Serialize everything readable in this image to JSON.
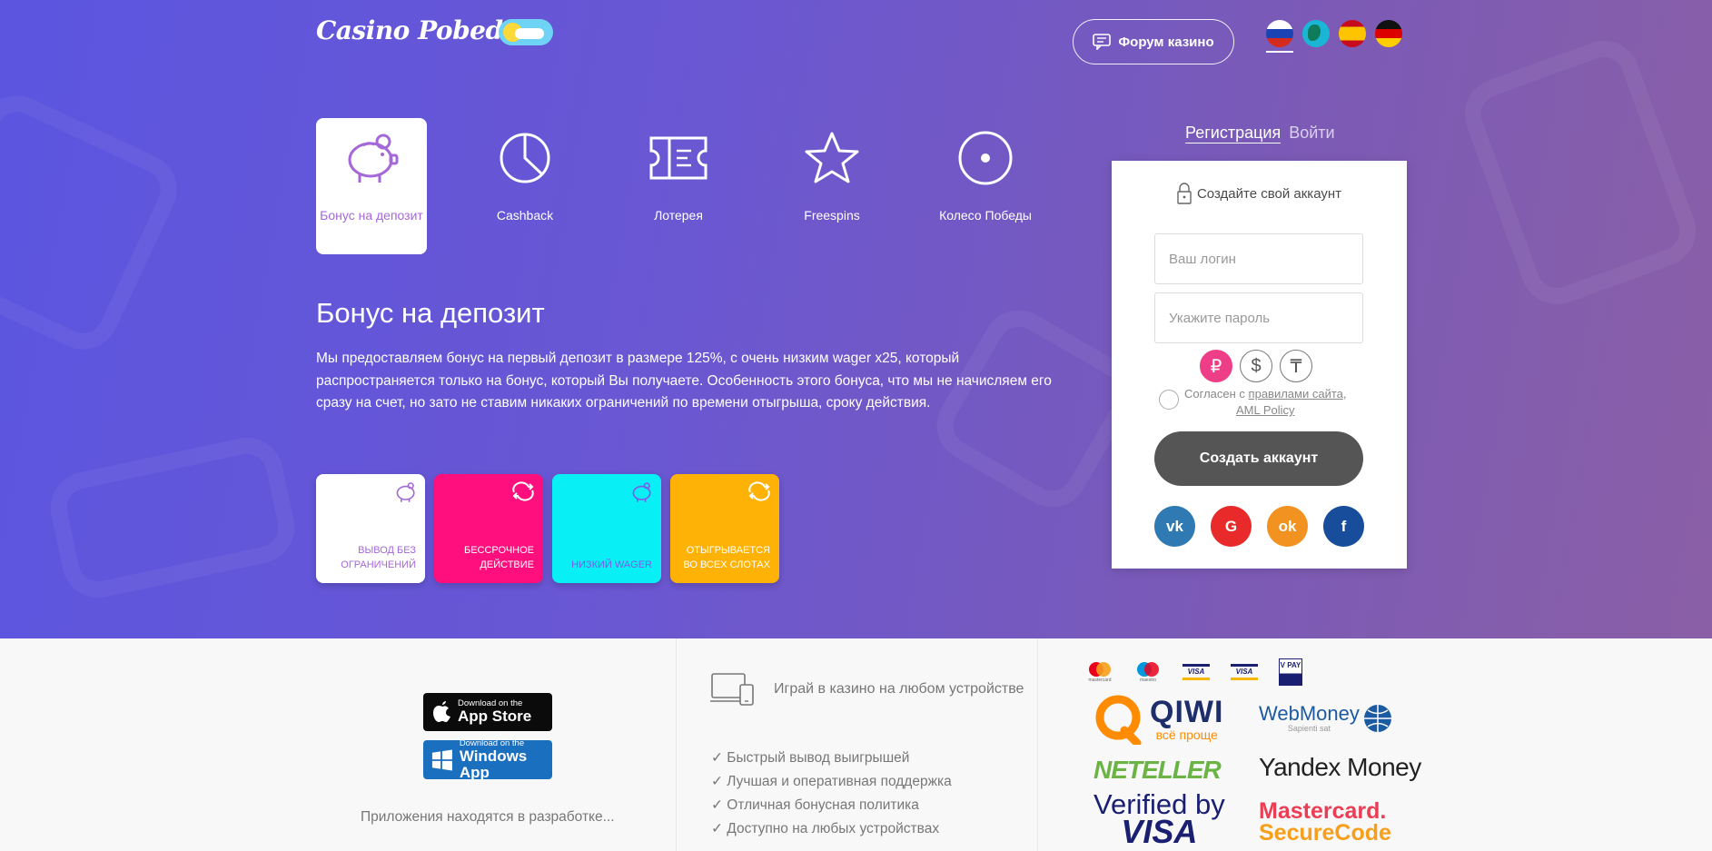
{
  "header": {
    "logo_text": "Casino Pobeda",
    "forum_button": "Форум казино",
    "languages": [
      {
        "name": "Russian",
        "icon": "flag-ru-icon"
      },
      {
        "name": "World",
        "icon": "globe-icon"
      },
      {
        "name": "Spanish",
        "icon": "flag-es-icon"
      },
      {
        "name": "German",
        "icon": "flag-de-icon"
      }
    ]
  },
  "bonus_tabs": [
    {
      "label": "Бонус на депозит",
      "icon": "piggy-bank-icon",
      "active": true
    },
    {
      "label": "Cashback",
      "icon": "pie-chart-icon",
      "active": false
    },
    {
      "label": "Лотерея",
      "icon": "ticket-icon",
      "active": false
    },
    {
      "label": "Freespins",
      "icon": "star-icon",
      "active": false
    },
    {
      "label": "Колесо Победы",
      "icon": "wheel-icon",
      "active": false
    }
  ],
  "section": {
    "title": "Бонус на депозит",
    "text": "Мы предоставляем бонус на первый депозит в размере 125%, с очень низким wager x25, который распространяется только на бонус, который Вы получаете. Особенность этого бонуса, что мы не начисляем его сразу на счет, но зато не ставим никаких ограничений по времени отыгрыша, сроку действия."
  },
  "feature_cards": [
    {
      "line1": "Вывод без",
      "line2": "ограничений",
      "icon": "piggy-bank-icon",
      "color": "#ffffff"
    },
    {
      "line1": "Бессрочное",
      "line2": "действие",
      "icon": "refresh-icon",
      "color": "#ff0f7d"
    },
    {
      "line1": "",
      "line2": "Низкий wager",
      "icon": "piggy-bank-icon",
      "color": "#08f0f5"
    },
    {
      "line1": "Отыгрывается",
      "line2": "во всех слотах",
      "icon": "refresh-icon",
      "color": "#ffb206"
    }
  ],
  "auth": {
    "tab_register": "Регистрация",
    "tab_login": "Войти",
    "panel_title": "Создайте свой аккаунт",
    "login_placeholder": "Ваш логин",
    "password_placeholder": "Укажите пароль",
    "currencies": [
      {
        "symbol": "₽",
        "name": "ruble-icon",
        "active": true
      },
      {
        "symbol": "$",
        "name": "dollar-icon",
        "active": false
      },
      {
        "symbol": "₸",
        "name": "tenge-icon",
        "active": false
      }
    ],
    "agree_prefix": "Согласен с",
    "agree_link1": "правилами сайта",
    "agree_link2": "AML Policy",
    "submit_label": "Создать аккаунт",
    "socials": [
      {
        "label": "vk",
        "icon": "vk-icon"
      },
      {
        "label": "G",
        "icon": "google-icon"
      },
      {
        "label": "ok",
        "icon": "odnoklassniki-icon"
      },
      {
        "label": "f",
        "icon": "facebook-icon"
      }
    ]
  },
  "footer": {
    "app_store": {
      "small": "Download on the",
      "big": "App Store"
    },
    "windows_app": {
      "small": "Download on the",
      "big": "Windows App"
    },
    "apps_note": "Приложения находятся в разработке...",
    "device_text": "Играй в казино на любом устройстве",
    "features": [
      "✓ Быстрый вывод выигрышей",
      "✓ Лучшая и оперативная поддержка",
      "✓ Отличная бонусная политика",
      "✓ Доступно на любых устройствах"
    ],
    "payments": {
      "small_logos": [
        "mastercard",
        "maestro",
        "VISA",
        "VISA",
        "V PAY"
      ],
      "qiwi": "QIWI",
      "qiwi_sub": "всё проще",
      "webmoney": "WebMoney",
      "webmoney_sub": "Sapienti sat",
      "neteller": "NETELLER",
      "yandex": "Yandex Money",
      "verified_line1": "Verified by",
      "verified_line2": "VISA",
      "mastercard_line1": "Mastercard.",
      "mastercard_line2": "SecureCode"
    }
  },
  "colors": {
    "hero_start": "#5b55e0",
    "hero_end": "#8a5fa6",
    "accent_purple": "#a568d8",
    "currency_active": "#ef3e88",
    "create_button": "#555555"
  }
}
